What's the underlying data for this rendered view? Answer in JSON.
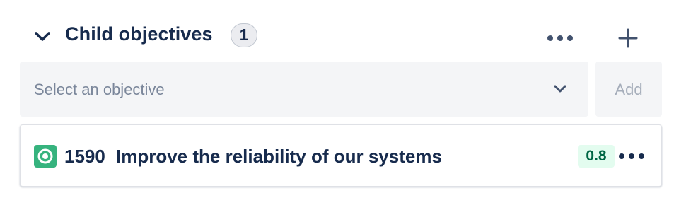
{
  "section": {
    "title": "Child objectives",
    "count": "1",
    "collapse_icon": "chevron-down-icon",
    "more_icon": "more-horizontal-icon",
    "add_icon": "plus-icon"
  },
  "selector": {
    "placeholder": "Select an objective",
    "chevron_icon": "chevron-down-icon",
    "add_label": "Add"
  },
  "objectives": [
    {
      "icon": "objective-target-icon",
      "key": "1590",
      "title": "Improve the reliability of our systems",
      "score": "0.8",
      "more_icon": "more-horizontal-icon"
    }
  ],
  "colors": {
    "text": "#172b4d",
    "objective_icon": "#36b37e",
    "score_bg": "#e3fcef",
    "score_text": "#006644",
    "input_bg": "#f4f5f7",
    "placeholder": "#7a869a"
  }
}
